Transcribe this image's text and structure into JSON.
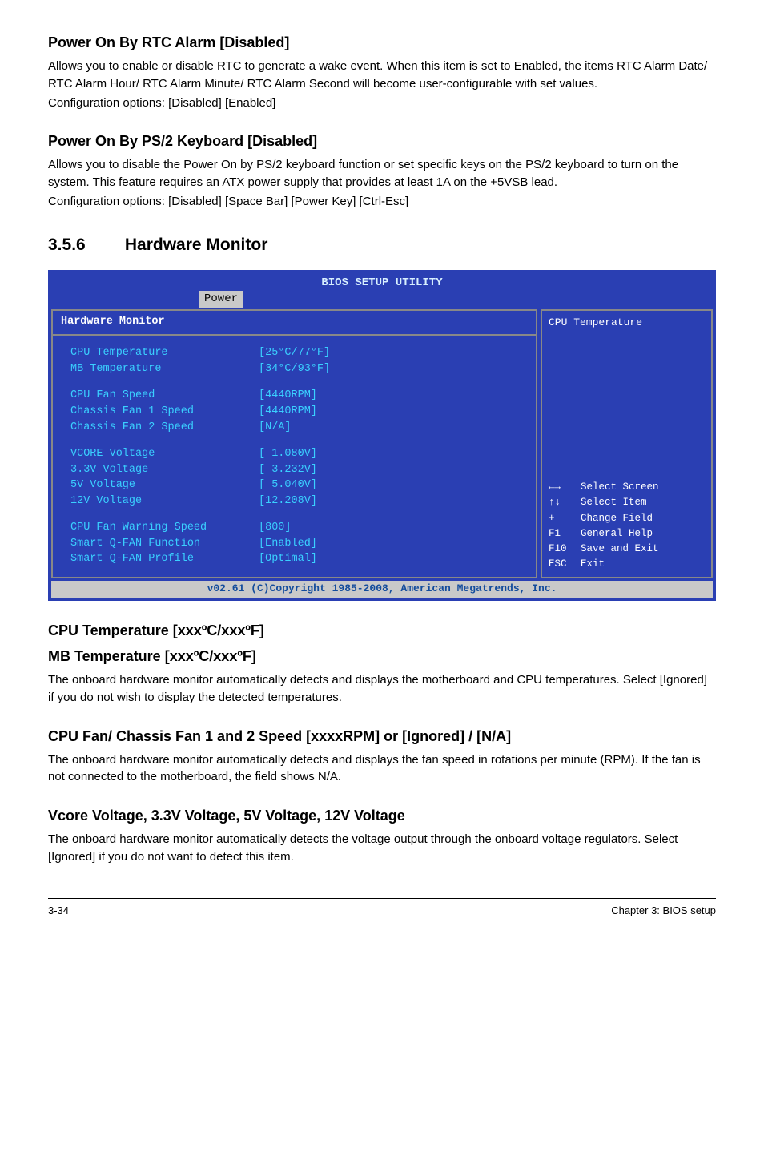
{
  "sec1": {
    "title": "Power On By RTC Alarm [Disabled]",
    "p1": "Allows you to enable or disable RTC to generate a wake event. When this item is set to Enabled, the items RTC Alarm Date/ RTC Alarm Hour/ RTC Alarm Minute/ RTC Alarm Second will become user-configurable with set values.",
    "p2": "Configuration options: [Disabled] [Enabled]"
  },
  "sec2": {
    "title": "Power On By PS/2 Keyboard [Disabled]",
    "p1": "Allows you to disable the Power On by PS/2 keyboard function or set specific keys on the PS/2 keyboard to turn on the system. This feature requires an ATX power supply that provides at least 1A on the +5VSB lead.",
    "p2": "Configuration options: [Disabled] [Space Bar] [Power Key] [Ctrl-Esc]"
  },
  "num_head_num": "3.5.6",
  "num_head_text": "Hardware Monitor",
  "bios": {
    "title": "BIOS SETUP UTILITY",
    "tab": "Power",
    "panel_head": "Hardware Monitor",
    "groups": [
      [
        {
          "label": "CPU Temperature",
          "val": "[25°C/77°F]"
        },
        {
          "label": "MB Temperature",
          "val": "[34°C/93°F]"
        }
      ],
      [
        {
          "label": "CPU Fan Speed",
          "val": "[4440RPM]"
        },
        {
          "label": "Chassis Fan 1 Speed",
          "val": "[4440RPM]"
        },
        {
          "label": "Chassis Fan 2 Speed",
          "val": "[N/A]"
        }
      ],
      [
        {
          "label": "VCORE Voltage",
          "val": "[ 1.080V]"
        },
        {
          "label": "3.3V Voltage",
          "val": "[ 3.232V]"
        },
        {
          "label": "5V Voltage",
          "val": "[ 5.040V]"
        },
        {
          "label": "12V Voltage",
          "val": "[12.208V]"
        }
      ],
      [
        {
          "label": "CPU Fan Warning Speed",
          "val": "[800]"
        },
        {
          "label": "Smart Q-FAN Function",
          "val": "[Enabled]"
        },
        {
          "label": "Smart Q-FAN Profile",
          "val": "[Optimal]"
        }
      ]
    ],
    "right_top": "CPU Temperature",
    "help": [
      {
        "key": "arrow-lr",
        "text": "Select Screen"
      },
      {
        "key": "arrow-ud",
        "text": "Select Item"
      },
      {
        "key": "+-",
        "text": "Change Field"
      },
      {
        "key": "F1",
        "text": "General Help"
      },
      {
        "key": "F10",
        "text": "Save and Exit"
      },
      {
        "key": "ESC",
        "text": "Exit"
      }
    ],
    "footer": "v02.61 (C)Copyright 1985-2008, American Megatrends, Inc."
  },
  "sec3": {
    "title1": "CPU Temperature [xxxºC/xxxºF]",
    "title2": "MB Temperature [xxxºC/xxxºF]",
    "p": "The onboard hardware monitor automatically detects and displays the motherboard and CPU temperatures. Select [Ignored] if you do not wish to display the detected temperatures."
  },
  "sec4": {
    "title": "CPU Fan/ Chassis Fan 1 and 2 Speed [xxxxRPM] or [Ignored] / [N/A]",
    "p": "The onboard hardware monitor automatically detects and displays the fan speed in rotations per minute (RPM). If the fan is not connected to the motherboard, the field shows N/A."
  },
  "sec5": {
    "title": "Vcore Voltage, 3.3V Voltage, 5V Voltage, 12V Voltage",
    "p": "The onboard hardware monitor automatically detects the voltage output through the onboard voltage regulators. Select [Ignored] if you do not want to detect this item."
  },
  "footer": {
    "left": "3-34",
    "right": "Chapter 3: BIOS setup"
  }
}
